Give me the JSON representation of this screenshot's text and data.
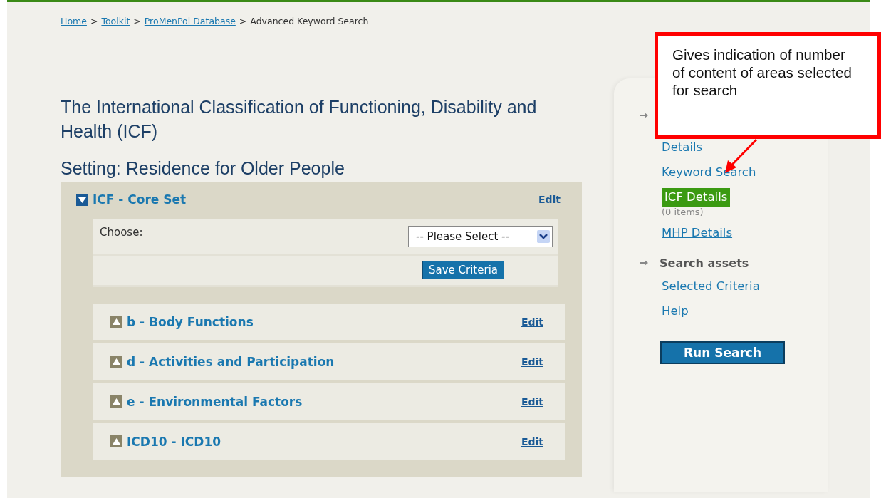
{
  "breadcrumb": {
    "links": [
      "Home",
      "Toolkit",
      "ProMenPol Database"
    ],
    "separator": ">",
    "current": "Advanced Keyword Search"
  },
  "title": "The International Classification of Functioning, Disability and Health (ICF)",
  "setting": "Setting: Residence for Older People",
  "core_set": {
    "title": "ICF - Core Set",
    "expanded": true,
    "edit": "Edit",
    "choose_label": "Choose:",
    "select": {
      "value": "-- Please Select --"
    },
    "save_button": "Save Criteria"
  },
  "sections": [
    {
      "title": "b - Body Functions",
      "expanded": false,
      "edit": "Edit"
    },
    {
      "title": "d - Activities and Participation",
      "expanded": false,
      "edit": "Edit"
    },
    {
      "title": "e - Environmental Factors",
      "expanded": false,
      "edit": "Edit"
    },
    {
      "title": "ICD10 - ICD10",
      "expanded": false,
      "edit": "Edit"
    }
  ],
  "sidebar": {
    "groups": [
      {
        "links": [
          {
            "label": "Details",
            "selected": false
          },
          {
            "label": "Keyword Search",
            "selected": false
          },
          {
            "label": "ICF Details",
            "selected": true,
            "note": "(0 items)"
          },
          {
            "label": "MHP Details",
            "selected": false
          }
        ]
      },
      {
        "heading": "Search assets",
        "links": [
          {
            "label": "Selected Criteria",
            "selected": false
          },
          {
            "label": "Help",
            "selected": false
          }
        ]
      }
    ],
    "run_button": "Run Search"
  },
  "annotation": {
    "text": "Gives indication of number of content of areas selected for search"
  }
}
